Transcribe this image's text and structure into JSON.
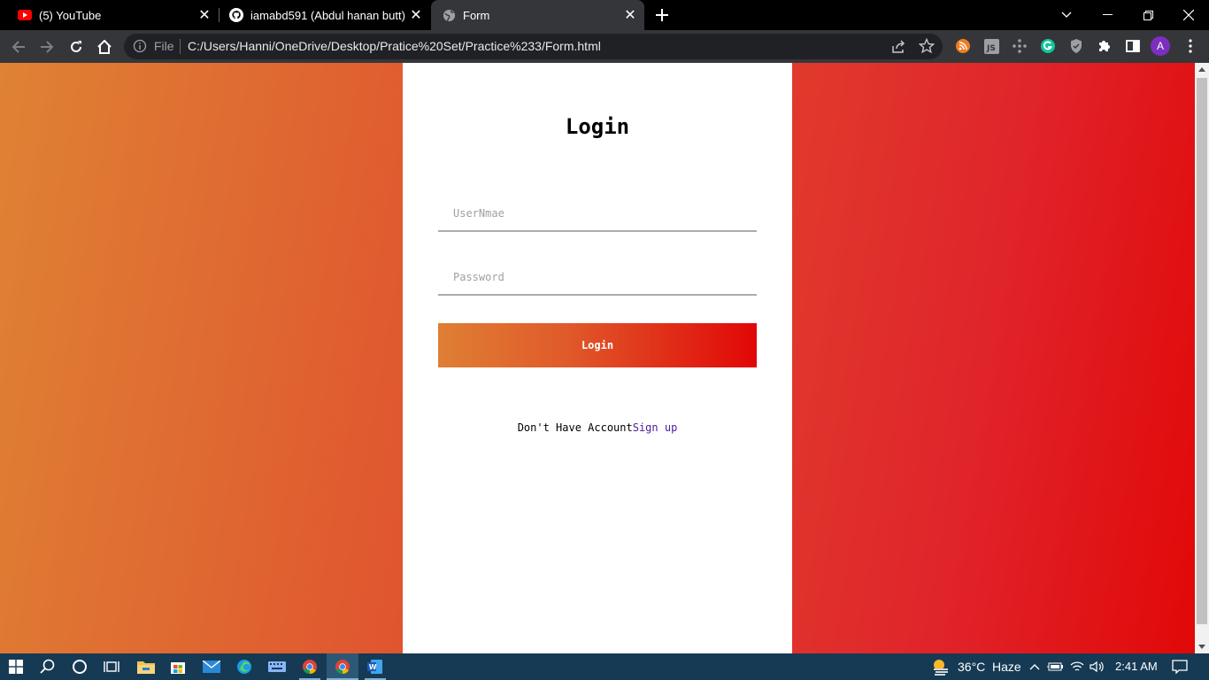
{
  "tabs": [
    {
      "title": "(5) YouTube",
      "favicon": "youtube-icon"
    },
    {
      "title": "iamabd591 (Abdul hanan butt)",
      "favicon": "github-icon"
    },
    {
      "title": "Form",
      "favicon": "globe-icon"
    }
  ],
  "address_bar": {
    "scheme_label": "File",
    "url": "C:/Users/Hanni/OneDrive/Desktop/Pratice%20Set/Practice%233/Form.html"
  },
  "profile_initial": "A",
  "page": {
    "heading": "Login",
    "username_placeholder": "UserNmae",
    "password_placeholder": "Password",
    "login_button": "Login",
    "signup_prompt": "Don't Have Account",
    "signup_link": "Sign up"
  },
  "taskbar": {
    "weather": "36°C",
    "weather_desc": "Haze",
    "time": "2:41 AM"
  },
  "colors": {
    "gradient_start": "#df8234",
    "gradient_end": "#e10808",
    "link": "#4b1b9a"
  }
}
